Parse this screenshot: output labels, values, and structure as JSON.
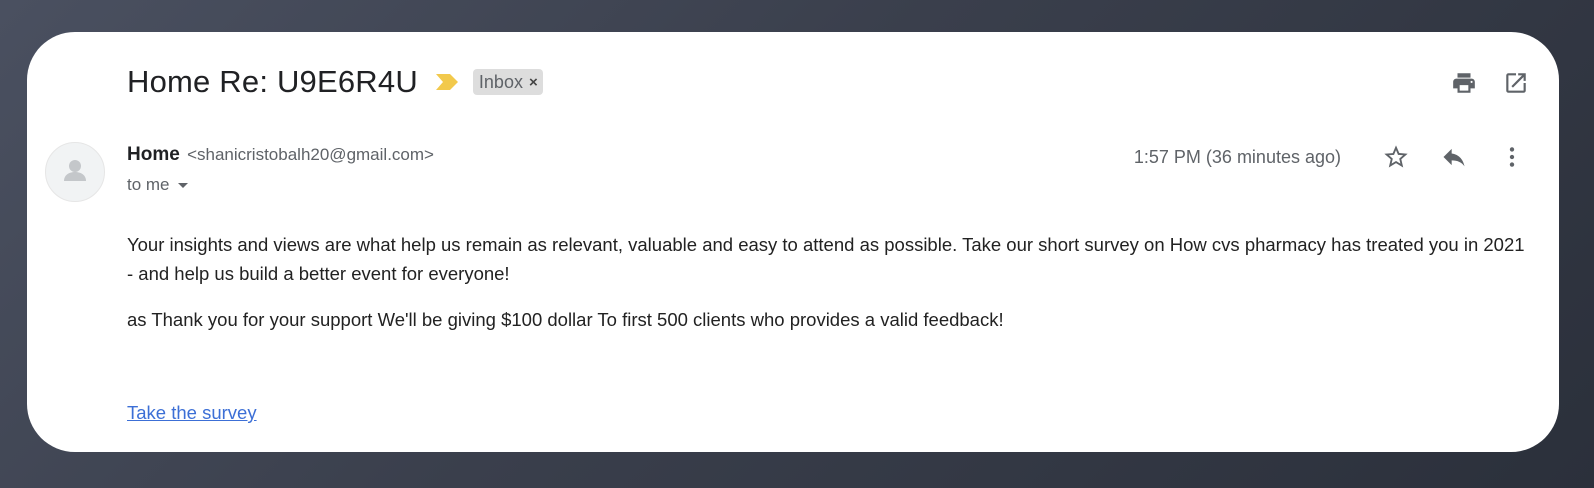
{
  "email": {
    "subject": "Home Re: U9E6R4U",
    "label": "Inbox",
    "label_remove": "×",
    "sender": {
      "name": "Home",
      "email": "<shanicristobalh20@gmail.com>"
    },
    "recipient": "to me",
    "timestamp": "1:57 PM (36 minutes ago)",
    "body": {
      "paragraph_1": "Your insights and views are what help us remain as relevant, valuable and easy to attend as possible. Take our short survey on How cvs pharmacy has treated you in 2021  - and help us build a better event for everyone!",
      "paragraph_2": "as Thank you for your support We'll be giving $100 dollar To first 500 clients who provides a valid feedback!"
    },
    "link_text": "Take the survey"
  },
  "icons": {
    "importance": "importance-marker-icon",
    "print": "print-icon",
    "open_new_window": "open-in-new-window-icon",
    "star": "star-icon",
    "reply": "reply-icon",
    "more": "more-vertical-icon",
    "avatar": "default-avatar-icon"
  },
  "colors": {
    "importance_marker": "#f2c94c",
    "link": "#3c6fd6",
    "label_chip_bg": "#dddddd"
  }
}
